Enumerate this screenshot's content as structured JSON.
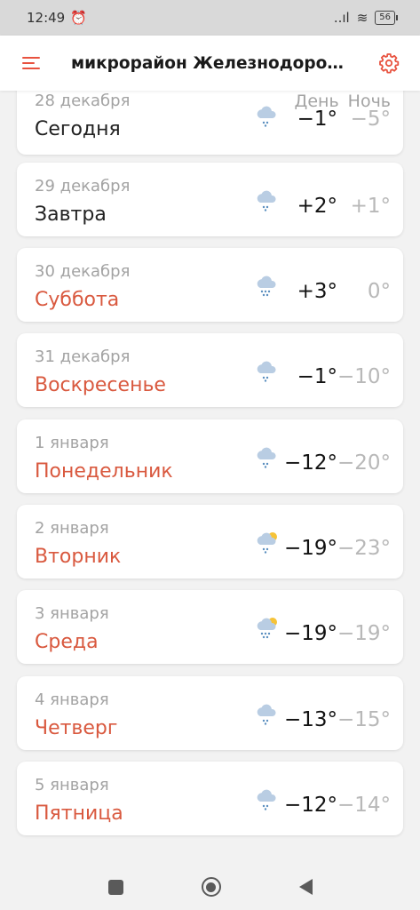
{
  "status_bar": {
    "time": "12:49",
    "signal": "..ıl",
    "wifi": "≋",
    "battery": "56"
  },
  "header": {
    "location": "микрорайон Железнодорож..."
  },
  "columns": {
    "day": "День",
    "night": "Ночь"
  },
  "days": [
    {
      "date": "28 декабря",
      "name": "Сегодня",
      "weekend": false,
      "day_temp": "−1°",
      "night_temp": "−5°",
      "icon": "cloud-snow-icon"
    },
    {
      "date": "29 декабря",
      "name": "Завтра",
      "weekend": false,
      "day_temp": "+2°",
      "night_temp": "+1°",
      "icon": "cloud-snow-icon"
    },
    {
      "date": "30 декабря",
      "name": "Суббота",
      "weekend": true,
      "day_temp": "+3°",
      "night_temp": "0°",
      "icon": "cloud-heavy-snow-icon"
    },
    {
      "date": "31 декабря",
      "name": "Воскресенье",
      "weekend": true,
      "day_temp": "−1°",
      "night_temp": "−10°",
      "icon": "cloud-snow-icon"
    },
    {
      "date": "1 января",
      "name": "Понедельник",
      "weekend": true,
      "day_temp": "−12°",
      "night_temp": "−20°",
      "icon": "cloud-snow-icon"
    },
    {
      "date": "2 января",
      "name": "Вторник",
      "weekend": true,
      "day_temp": "−19°",
      "night_temp": "−23°",
      "icon": "sun-cloud-snow-icon"
    },
    {
      "date": "3 января",
      "name": "Среда",
      "weekend": true,
      "day_temp": "−19°",
      "night_temp": "−19°",
      "icon": "sun-cloud-heavy-snow-icon"
    },
    {
      "date": "4 января",
      "name": "Четверг",
      "weekend": true,
      "day_temp": "−13°",
      "night_temp": "−15°",
      "icon": "cloud-snow-icon"
    },
    {
      "date": "5 января",
      "name": "Пятница",
      "weekend": true,
      "day_temp": "−12°",
      "night_temp": "−14°",
      "icon": "cloud-snow-icon"
    }
  ],
  "colors": {
    "accent": "#e8523f",
    "weekend": "#d9593f",
    "cloud": "#b9cde3",
    "snow": "#5b8fbf",
    "sun": "#f6c337"
  }
}
